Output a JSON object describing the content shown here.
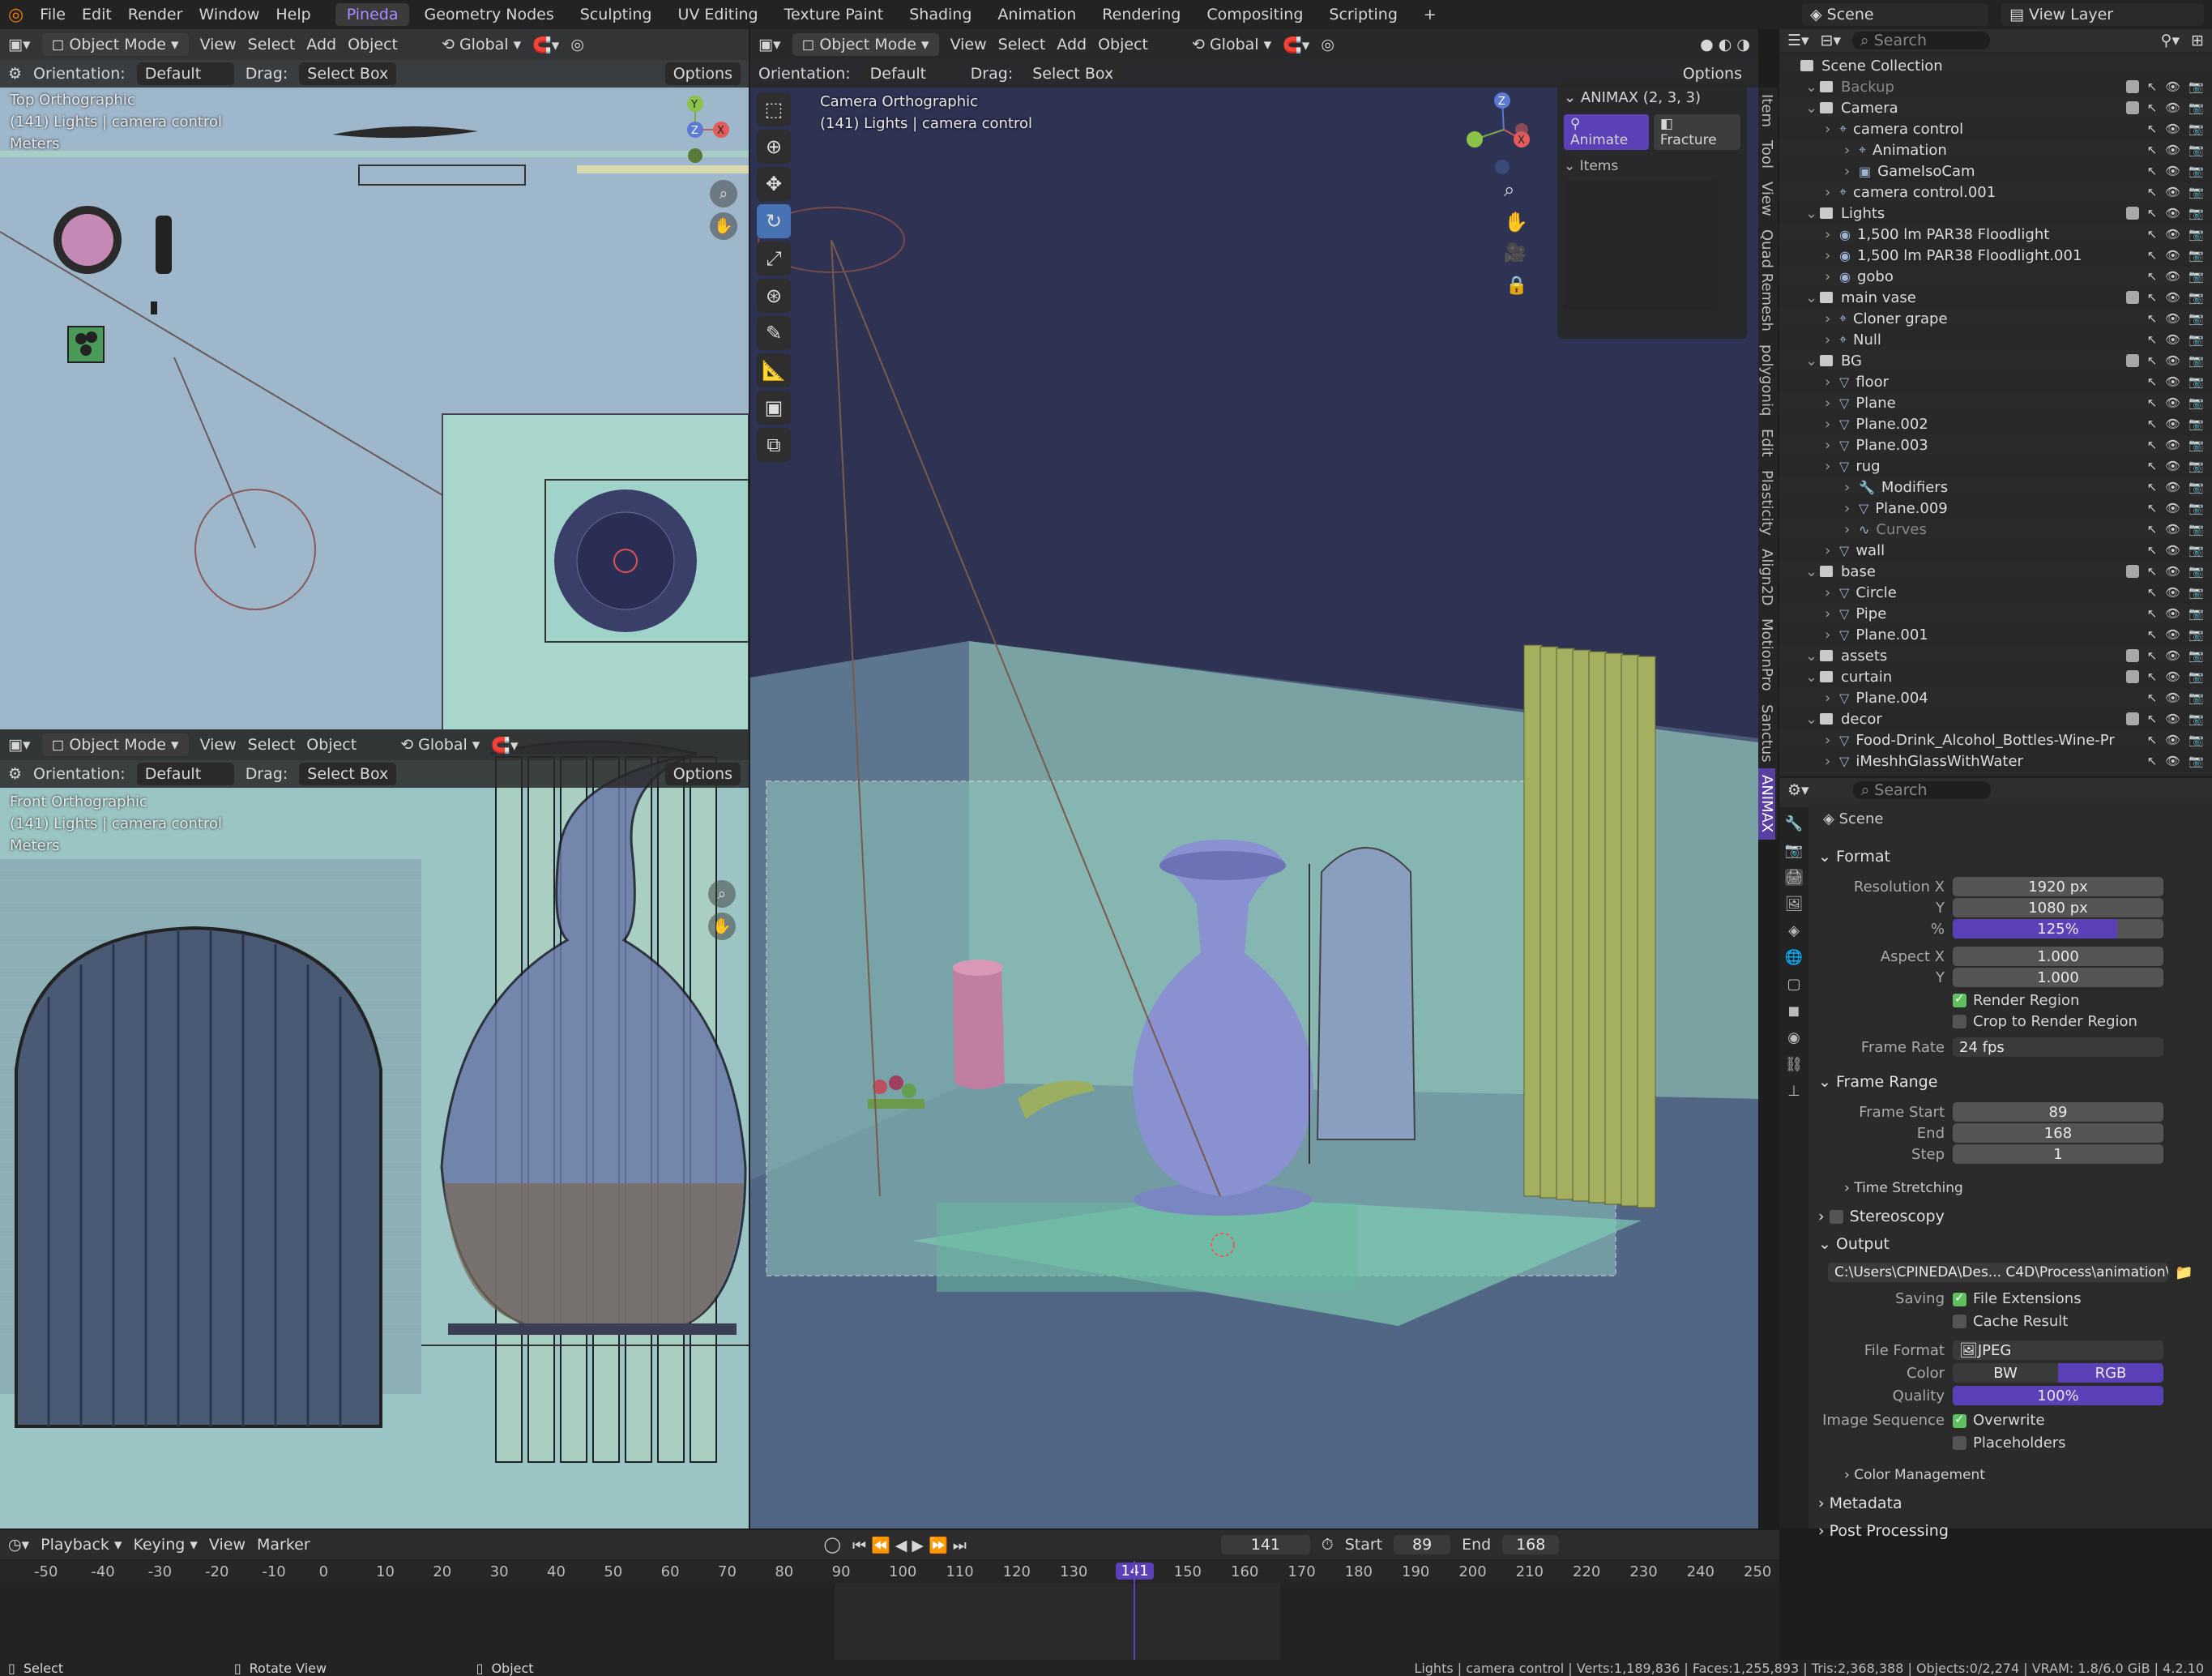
{
  "menubar": {
    "menus": [
      "File",
      "Edit",
      "Render",
      "Window",
      "Help"
    ],
    "workspaces": [
      "Pineda",
      "Geometry Nodes",
      "Sculpting",
      "UV Editing",
      "Texture Paint",
      "Shading",
      "Animation",
      "Rendering",
      "Compositing",
      "Scripting"
    ],
    "active_workspace": "Pineda",
    "add_ws": "+",
    "scene": "Scene",
    "view_layer": "View Layer"
  },
  "viewport_header": {
    "mode": "Object Mode",
    "menus": [
      "View",
      "Select",
      "Add",
      "Object"
    ],
    "transform": "Global",
    "orientation_label": "Orientation:",
    "orientation": "Default",
    "drag_label": "Drag:",
    "drag": "Select Box",
    "options": "Options"
  },
  "top_view": {
    "name": "Top Orthographic",
    "info": "(141) Lights | camera control",
    "units": "Meters"
  },
  "front_view": {
    "name": "Front Orthographic",
    "info": "(141) Lights | camera control",
    "units": "Meters"
  },
  "camera_view": {
    "name": "Camera Orthographic",
    "info": "(141) Lights | camera control"
  },
  "gizmo": {
    "x": "X",
    "y": "Y",
    "z": "Z",
    "ny": "-Y"
  },
  "animax": {
    "title": "ANIMAX (2, 3, 3)",
    "animate": "Animate",
    "fracture": "Fracture",
    "items": "Items"
  },
  "sidebar_tabs": [
    "Item",
    "Tool",
    "View",
    "Quad Remesh",
    "polygoniq",
    "Edit",
    "Plasticity",
    "Align2D",
    "MotionPro",
    "Sanctus",
    "ANIMAX"
  ],
  "outliner": {
    "search_placeholder": "Search",
    "rows": [
      {
        "label": "Scene Collection",
        "indent": 0,
        "type": "root"
      },
      {
        "label": "Backup",
        "indent": 1,
        "type": "coll",
        "dim": true
      },
      {
        "label": "Camera",
        "indent": 1,
        "type": "coll"
      },
      {
        "label": "camera control",
        "indent": 2,
        "type": "obj"
      },
      {
        "label": "Animation",
        "indent": 3,
        "type": "obj"
      },
      {
        "label": "GameIsoCam",
        "indent": 3,
        "type": "cam"
      },
      {
        "label": "camera control.001",
        "indent": 2,
        "type": "obj"
      },
      {
        "label": "Lights",
        "indent": 1,
        "type": "coll"
      },
      {
        "label": "1,500 lm PAR38 Floodlight",
        "indent": 2,
        "type": "light"
      },
      {
        "label": "1,500 lm PAR38 Floodlight.001",
        "indent": 2,
        "type": "light"
      },
      {
        "label": "gobo",
        "indent": 2,
        "type": "light"
      },
      {
        "label": "main vase",
        "indent": 1,
        "type": "coll"
      },
      {
        "label": "Cloner grape",
        "indent": 2,
        "type": "obj"
      },
      {
        "label": "Null",
        "indent": 2,
        "type": "obj"
      },
      {
        "label": "BG",
        "indent": 1,
        "type": "coll"
      },
      {
        "label": "floor",
        "indent": 2,
        "type": "mesh"
      },
      {
        "label": "Plane",
        "indent": 2,
        "type": "mesh"
      },
      {
        "label": "Plane.002",
        "indent": 2,
        "type": "mesh"
      },
      {
        "label": "Plane.003",
        "indent": 2,
        "type": "mesh"
      },
      {
        "label": "rug",
        "indent": 2,
        "type": "mesh"
      },
      {
        "label": "Modifiers",
        "indent": 3,
        "type": "mod"
      },
      {
        "label": "Plane.009",
        "indent": 3,
        "type": "mesh"
      },
      {
        "label": "Curves",
        "indent": 3,
        "type": "curve",
        "dim": true
      },
      {
        "label": "wall",
        "indent": 2,
        "type": "mesh"
      },
      {
        "label": "base",
        "indent": 1,
        "type": "coll"
      },
      {
        "label": "Circle",
        "indent": 2,
        "type": "mesh"
      },
      {
        "label": "Pipe",
        "indent": 2,
        "type": "mesh"
      },
      {
        "label": "Plane.001",
        "indent": 2,
        "type": "mesh"
      },
      {
        "label": "assets",
        "indent": 1,
        "type": "coll"
      },
      {
        "label": "curtain",
        "indent": 1,
        "type": "coll"
      },
      {
        "label": "Plane.004",
        "indent": 2,
        "type": "mesh"
      },
      {
        "label": "decor",
        "indent": 1,
        "type": "coll"
      },
      {
        "label": "Food-Drink_Alcohol_Bottles-Wine-Pr",
        "indent": 2,
        "type": "mesh"
      },
      {
        "label": "iMeshhGlassWithWater",
        "indent": 2,
        "type": "mesh"
      }
    ]
  },
  "properties": {
    "search_placeholder": "Search",
    "context": "Scene",
    "format": "Format",
    "res_x_label": "Resolution X",
    "res_x": "1920 px",
    "y_label": "Y",
    "res_y": "1080 px",
    "pct_label": "%",
    "pct": "125%",
    "pct_value": 1.25,
    "aspect_x_label": "Aspect X",
    "aspect_x": "1.000",
    "aspect_y": "1.000",
    "render_region": "Render Region",
    "crop": "Crop to Render Region",
    "frame_rate_label": "Frame Rate",
    "frame_rate": "24 fps",
    "frame_range": "Frame Range",
    "frame_start_label": "Frame Start",
    "frame_start": "89",
    "end_label": "End",
    "end": "168",
    "step_label": "Step",
    "step": "1",
    "time_stretching": "Time Stretching",
    "stereoscopy": "Stereoscopy",
    "output": "Output",
    "path": "C:\\Users\\CPINEDA\\Des... C4D\\Process\\animation\\",
    "saving_label": "Saving",
    "file_ext": "File Extensions",
    "cache": "Cache Result",
    "file_format_label": "File Format",
    "file_format": "JPEG",
    "color_label": "Color",
    "bw": "BW",
    "rgb": "RGB",
    "quality_label": "Quality",
    "quality": "100%",
    "quality_value": 1.0,
    "image_seq_label": "Image Sequence",
    "overwrite": "Overwrite",
    "placeholders": "Placeholders",
    "color_mgmt": "Color Management",
    "metadata": "Metadata",
    "post": "Post Processing"
  },
  "timeline": {
    "menus": [
      "Playback",
      "Keying",
      "View",
      "Marker"
    ],
    "current": "141",
    "start_label": "Start",
    "start": "89",
    "end_label": "End",
    "end": "168",
    "ticks": [
      -50,
      -40,
      -30,
      -20,
      -10,
      0,
      10,
      20,
      30,
      40,
      50,
      60,
      70,
      80,
      90,
      100,
      110,
      120,
      130,
      140,
      150,
      160,
      170,
      180,
      190,
      200,
      210,
      220,
      230,
      240,
      250
    ]
  },
  "statusbar": {
    "select": "Select",
    "rotate": "Rotate View",
    "object": "Object",
    "stats": "Lights | camera control | Verts:1,189,836 | Faces:1,255,893 | Tris:2,368,388 | Objects:0/2,274 | VRAM: 1.8/6.0 GiB | 4.2.10"
  },
  "colors": {
    "accent": "#5b40b8",
    "select_blue": "#4772b3",
    "bg_viewport": "#2c3250",
    "teal": "#9dc7c4"
  }
}
